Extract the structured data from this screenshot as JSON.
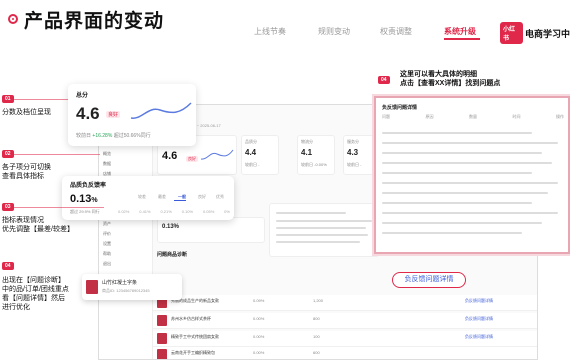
{
  "header": {
    "title": "产品界面的变动",
    "nav": [
      "上线节奏",
      "规则变动",
      "权责调整",
      "系统升级"
    ],
    "active_nav": "系统升级",
    "brand_logo": "小红书",
    "brand_text": "电商学习中"
  },
  "steps": [
    {
      "num": "01",
      "text": "分数及档位呈现"
    },
    {
      "num": "02",
      "text_lines": [
        "各子项分可切换",
        "查看具体指标"
      ]
    },
    {
      "num": "03",
      "text_lines": [
        "指标表现情况",
        "优先调整【最差/较差】"
      ]
    },
    {
      "num": "04",
      "text_lines": [
        "出现在【问题诊断】",
        "中的品/订单/团线重点",
        "看【问题详情】然后",
        "进行优化"
      ]
    },
    {
      "num": "04",
      "text_lines": [
        "这里可以看大具体的明细",
        "点击【查看XX详情】找到问题点"
      ]
    }
  ],
  "score_card": {
    "title": "总分",
    "score": "4.6",
    "badge": "良好",
    "foot_a": "较前日",
    "foot_b": "+16.28%",
    "foot_c": "超过50.66%同行"
  },
  "dashboard": {
    "breadcrumb": "统计时间: 2025-03-19 ~ 2025-06-17",
    "score": "4.6",
    "badge": "良好",
    "sub_cards": [
      {
        "label": "品质分",
        "value": "4.4",
        "sub": "较前日 -"
      },
      {
        "label": "物流分",
        "value": "4.1",
        "sub": "较前日 -0.00%"
      },
      {
        "label": "服务分",
        "value": "4.3",
        "sub": "较前日 -"
      }
    ],
    "sidebar": [
      "概览",
      "数据",
      "店铺",
      "商品",
      "订单",
      "售后",
      "营销",
      "资产",
      "评价",
      "设置",
      "帮助",
      "退出"
    ],
    "metric_title": "品质负反馈率",
    "metric_value": "0.13%",
    "diag_title": "问题商品诊断",
    "table_rows": [
      {
        "name": "秀丽的成品生产的新品女款",
        "rate": "0.09%",
        "tag": "问题较多",
        "count": "1,200",
        "link": "负反馈问题详情"
      },
      {
        "name": "苏州水乡仿古样式茶杯",
        "rate": "0.00%",
        "tag": "",
        "count": "800",
        "link": "负反馈问题详情"
      },
      {
        "name": "精致手工中式传统团扇女款",
        "rate": "0.00%",
        "tag": "",
        "count": "100",
        "link": "负反馈问题详情"
      },
      {
        "name": "云南花开手工编织精致包",
        "rate": "0.00%",
        "tag": "",
        "count": "600",
        "link": "负反馈问题详情"
      }
    ]
  },
  "quality_popup": {
    "title": "品质负反馈率",
    "tabs": [
      "较差",
      "最差",
      "一般",
      "良好",
      "优秀"
    ],
    "active_tab": "一般",
    "value": "0.13",
    "unit": "%",
    "foot": "超过 29.9% 同行",
    "scale": [
      "0.02%",
      "0.41%",
      "0.21%",
      "0.10%",
      "0.05%",
      "0%"
    ]
  },
  "diag_popup": {
    "name": "山竹红凝土字条",
    "id": "商品ID: 123456789012345"
  },
  "feedback_button": "负反馈问题详情",
  "detail_panel": {
    "title": "负反馈问题详情",
    "columns": [
      "问题",
      "原因",
      "数量",
      "时间",
      "操作"
    ]
  },
  "colors": {
    "accent": "#e0284a",
    "link": "#3a5bd9"
  }
}
